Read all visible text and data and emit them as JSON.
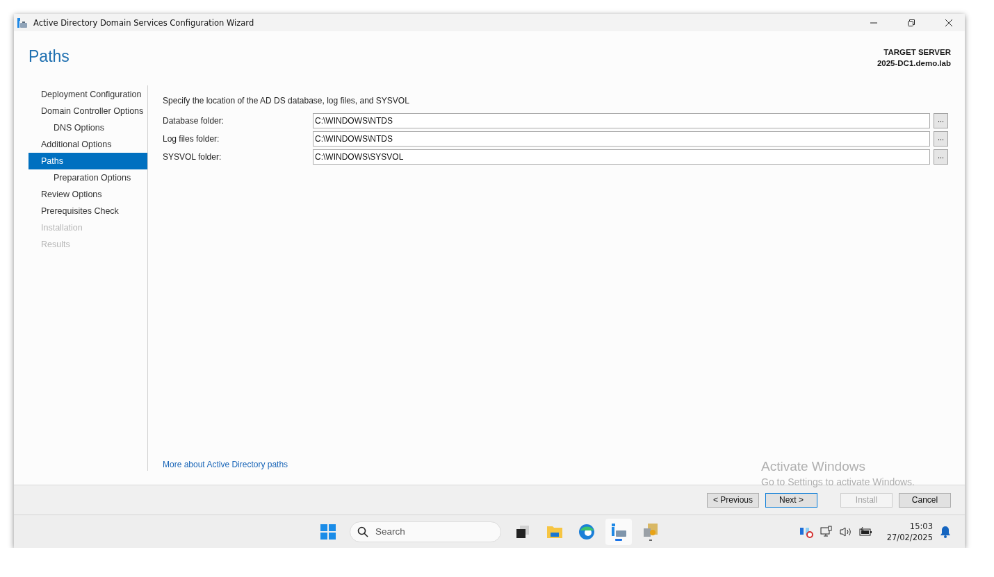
{
  "window": {
    "title": "Active Directory Domain Services Configuration Wizard"
  },
  "header": {
    "page_title": "Paths",
    "server_label": "TARGET SERVER",
    "server_name": "2025-DC1.demo.lab"
  },
  "nav": [
    {
      "label": "Deployment Configuration",
      "selected": false,
      "disabled": false
    },
    {
      "label": "Domain Controller Options",
      "selected": false,
      "disabled": false,
      "children": [
        {
          "label": "DNS Options",
          "selected": false,
          "disabled": false
        }
      ]
    },
    {
      "label": "Additional Options",
      "selected": false,
      "disabled": false
    },
    {
      "label": "Paths",
      "selected": true,
      "disabled": false,
      "children": [
        {
          "label": "Preparation Options",
          "selected": false,
          "disabled": false
        }
      ]
    },
    {
      "label": "Review Options",
      "selected": false,
      "disabled": false
    },
    {
      "label": "Prerequisites Check",
      "selected": false,
      "disabled": false
    },
    {
      "label": "Installation",
      "selected": false,
      "disabled": true
    },
    {
      "label": "Results",
      "selected": false,
      "disabled": true
    }
  ],
  "content": {
    "instruction": "Specify the location of the AD DS database, log files, and SYSVOL",
    "fields": [
      {
        "label": "Database folder:",
        "value": "C:\\WINDOWS\\NTDS",
        "browse": "..."
      },
      {
        "label": "Log files folder:",
        "value": "C:\\WINDOWS\\NTDS",
        "browse": "..."
      },
      {
        "label": "SYSVOL folder:",
        "value": "C:\\WINDOWS\\SYSVOL",
        "browse": "..."
      }
    ],
    "link": "More about Active Directory paths"
  },
  "activation": {
    "title": "Activate Windows",
    "message": "Go to Settings to activate Windows."
  },
  "buttons": [
    {
      "label": "< Previous",
      "default": false,
      "disabled": false
    },
    {
      "label": "Next >",
      "default": true,
      "disabled": false
    },
    {
      "label": "Install",
      "default": false,
      "disabled": true
    },
    {
      "label": "Cancel",
      "default": false,
      "disabled": false
    }
  ],
  "taskbar": {
    "search_placeholder": "Search",
    "time": "15:03",
    "date": "27/02/2025"
  }
}
